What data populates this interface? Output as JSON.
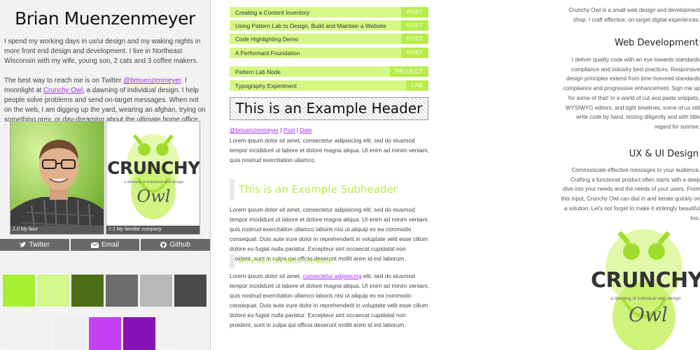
{
  "profile": {
    "name": "Brian Muenzenmeyer",
    "bio1": "I spend my working days in ux/ui design and my waking nights in more front end design and development. I live in Northeast Wisconsin with my wife, young son, 2 cats and 3 coffee makers.",
    "bio2_pre": "The best way to reach me is on Twitter ",
    "bio2_twitter": "@bmuenzenmeyer",
    "bio2_mid": ". I moonlight at ",
    "bio2_link": "Crunchy Owl",
    "bio2_post": ", a dawning of individual design. I help people solve problems and send on-target messages. When not on the web, I am digging up the yard, wearing an afghan, trying on something grey, or day-dreaming about the ultimate home office.",
    "figures": [
      {
        "caption": "1.0 My face"
      },
      {
        "caption": "1.1 My familiar company"
      }
    ],
    "social": [
      {
        "label": "Twitter",
        "icon": "twitter-icon"
      },
      {
        "label": "Email",
        "icon": "envelope-icon"
      },
      {
        "label": "Github",
        "icon": "github-icon"
      }
    ],
    "swatches_row1": [
      "#a6f032",
      "#d2f78a",
      "#4c6e18",
      "#6c6c6c",
      "#b8b8b8",
      "#4a4a4a"
    ],
    "swatches_row2": [
      "#efefef",
      "#c540f4",
      "#8a10b8"
    ]
  },
  "logo": {
    "word": "CRUNCHY",
    "tagline": "a dawning of individual web design",
    "owl": "Owl"
  },
  "patterns": {
    "group1": [
      {
        "title": "Creating a Content Inventory",
        "tag": "POST"
      },
      {
        "title": "Using Pattern Lab to Design, Build and Maintain a Website",
        "tag": "POST"
      },
      {
        "title": "Code Highlighting Demo",
        "tag": "POST"
      },
      {
        "title": "A Performant Foundation",
        "tag": "POST"
      }
    ],
    "group2": [
      {
        "title": "Pattern Lab Node",
        "tag": "PROJECT"
      },
      {
        "title": "Typography Experiment",
        "tag": "LAB"
      }
    ]
  },
  "article": {
    "header": "This is an Example Header",
    "meta_user": "@bmuenzenmeyer",
    "meta_sep": " | ",
    "meta_post": "Post",
    "meta_date": "Date",
    "para1": "Lorem ipsum dolor sit amet, consectetur adipisicing elit, sed do eiusmod tempor incididunt ut labore et dolore magna aliqua. Ut enim ad minim veniam, quis nostrud exercitation ullamco.",
    "subheader": "This is an Example Subheader",
    "para2": "Lorem ipsum dolor sit amet, consectetur adipisicing elit, sed do eiusmod tempor incididunt ut labore et dolore magna aliqua. Ut enim ad minim veniam, quis nostrud exercitation ullamco laboris nisi ut aliquip ex ea commodo consequat. Duis aute irure dolor in reprehenderit in voluptate velit esse cillum dolore eu fugiat nulla pariatur. Excepteur sint occaecat cupidatat non proident, sunt in culpa qui officia deserunt mollit anim id est laborum.",
    "smaller_header": "An Even Smaller Header",
    "para3_pre": "Lorem ipsum dolor sit amet, ",
    "para3_link": "consectetur adipisicing",
    "para3_post": " elit, sed do eiusmod tempor incididunt ut labore et dolore magna aliqua. Ut enim ad minim veniam, quis nostrud exercitation ullamco laboris nisi ut aliquip ex ea commodo consequat. Duis aute irure dolor in reprehenderit in voluptate velit esse cillum dolore eu fugiat nulla pariatur. Excepteur sint occaecat cupidatat non proident, sunt in culpa qui officia deserunt mollit anim id est laborum."
  },
  "about": {
    "intro": "Crunchy Owl is a small web design and development shop. I craft effective, on-target digital experiences.",
    "h1": "Web Development",
    "p1": "I deliver quality code with an eye towards standards compliance and industry best practices. Responsive design principles extend from time-honored standards compliance and progressive enhancement. Sign me up for some of that! In a world of cut and paste snippets, WYSIWYG editors, and tight timelines, some of us still write code by hand, testing diligently and with little regard for sunrise.",
    "h2": "UX & UI Design",
    "p2": "Communicate effective messages to your audience. Crafting a functional product often starts with a deep dive into your needs and the needs of your users. From this input, Crunchy Owl can dial in and iterate quickly on a solution. Let's not forget to make it strikingly beautiful too."
  }
}
